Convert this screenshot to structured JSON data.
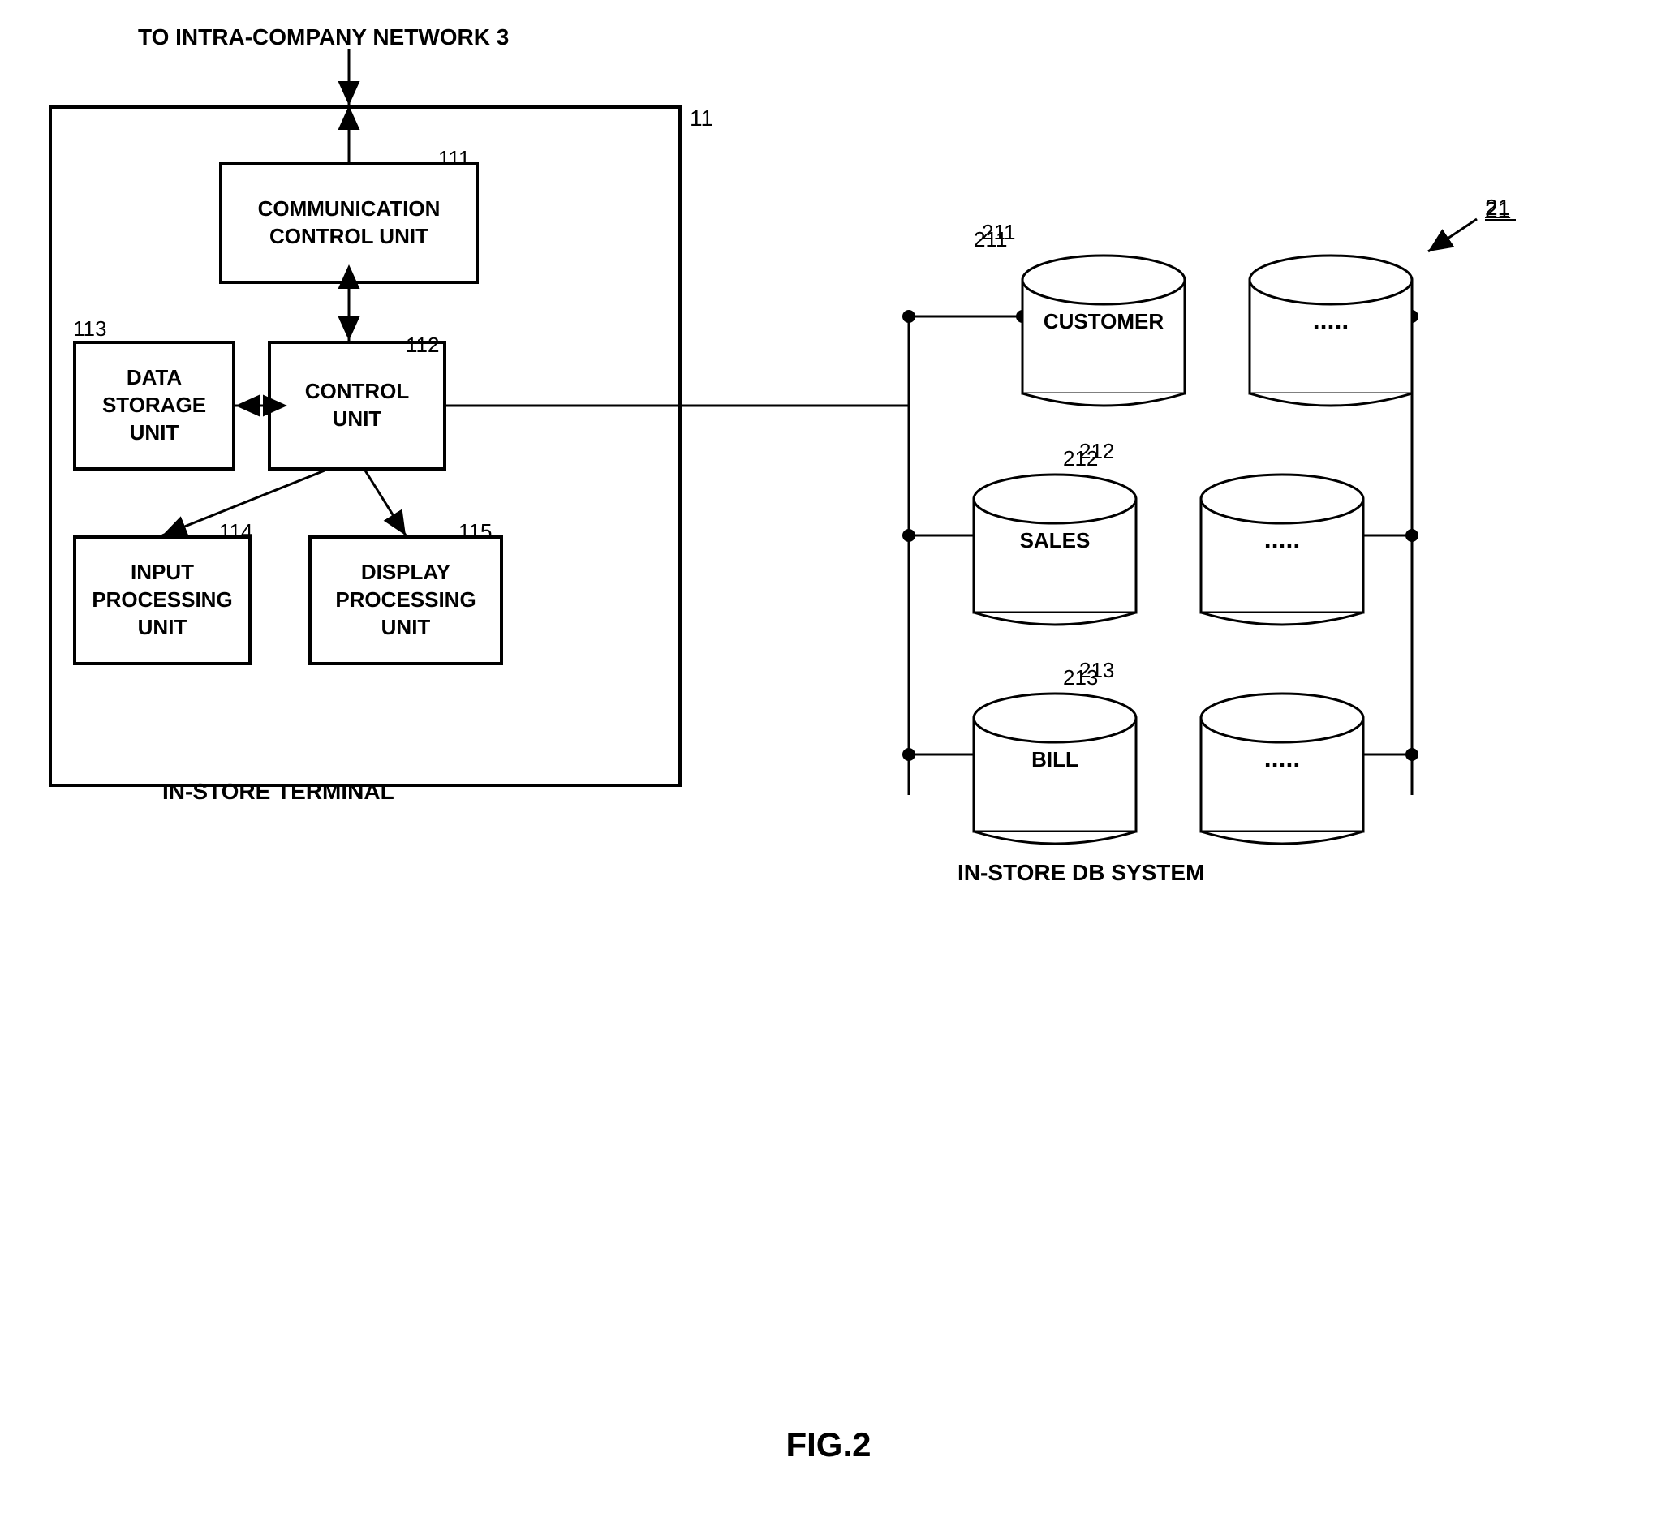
{
  "title": "FIG.2",
  "network_label": "TO INTRA-COMPANY NETWORK 3",
  "ref_main": "11",
  "ref_comm": "111",
  "ref_ctrl_arrow": "112",
  "ref_data_storage": "113",
  "ref_input": "114",
  "ref_display": "115",
  "ref_db_system": "21",
  "ref_customer_db": "211",
  "ref_sales_db": "212",
  "ref_bill_db": "213",
  "boxes": {
    "comm_control": "COMMUNICATION\nCONTROL UNIT",
    "control_unit": "CONTROL\nUNIT",
    "data_storage": "DATA\nSTORAGE\nUNIT",
    "input_processing": "INPUT\nPROCESSING\nUNIT",
    "display_processing": "DISPLAY\nPROCESSING\nUNIT"
  },
  "terminal_label": "IN-STORE TERMINAL",
  "db_system_label": "IN-STORE DB SYSTEM",
  "databases": [
    {
      "id": "customer",
      "label": "CUSTOMER",
      "ref": "211"
    },
    {
      "id": "sales",
      "label": "SALES",
      "ref": "212"
    },
    {
      "id": "bill",
      "label": "BILL",
      "ref": "213"
    }
  ],
  "dots": "....."
}
